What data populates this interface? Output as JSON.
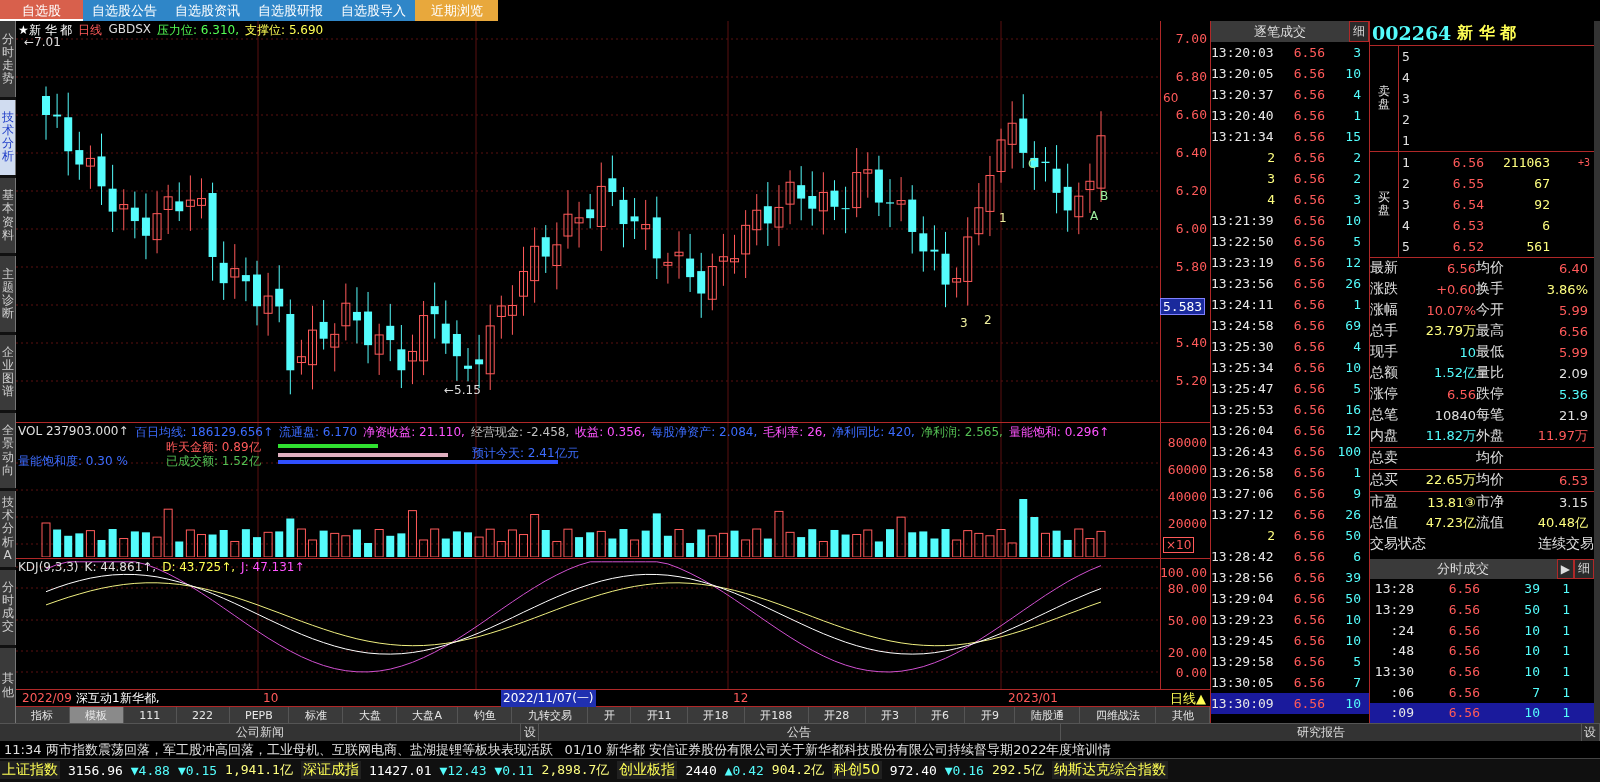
{
  "top_tabs": [
    {
      "label": "自选股",
      "selected": true,
      "color": "#d8604c"
    },
    {
      "label": "自选股公告",
      "selected": false,
      "color": "#2f86c8"
    },
    {
      "label": "自选股资讯",
      "selected": false,
      "color": "#2f86c8"
    },
    {
      "label": "自选股研报",
      "selected": false,
      "color": "#2f86c8"
    },
    {
      "label": "自选股导入",
      "selected": false,
      "color": "#2f86c8"
    },
    {
      "label": "近期浏览",
      "selected": false,
      "color": "#e8a83c"
    }
  ],
  "side_tabs": [
    {
      "label": "分时走势",
      "selected": false
    },
    {
      "label": "技术分析",
      "selected": true
    },
    {
      "label": "基本资料",
      "selected": false
    },
    {
      "label": "主题诊断",
      "selected": false
    },
    {
      "label": "企业图谱",
      "selected": false
    },
    {
      "label": "全景动向",
      "selected": false
    },
    {
      "label": "技术分析A",
      "selected": false
    },
    {
      "label": "分时成交",
      "selected": false
    },
    {
      "label": "其他",
      "selected": false
    }
  ],
  "price_panel": {
    "title": "★新 华 都",
    "period": "日线",
    "formula": "GBDSX",
    "resistance": "压力位: 6.310,",
    "support": "支撑位: 5.690",
    "high_marker": "←7.01",
    "low_marker": "←5.15",
    "wave_labels": [
      "1",
      "2",
      "3",
      "A",
      "B",
      "C"
    ],
    "axis": [
      "7.00",
      "6.80",
      "6.60",
      "6.40",
      "6.20",
      "6.00",
      "5.80",
      "5.40",
      "5.20"
    ],
    "axis_tag": "60",
    "current_price": "5.583"
  },
  "volume_panel": {
    "indicators": [
      {
        "text": "VOL 237903.000↑",
        "color": "#e0e0e0"
      },
      {
        "text": "百日均线: 186129.656↑",
        "color": "#3c6cff"
      },
      {
        "text": "流通盘: 6.170",
        "color": "#3c6cff"
      },
      {
        "text": "净资收益: 21.110,",
        "color": "#ff54ff"
      },
      {
        "text": "经营现金: -2.458,",
        "color": "#c0c0c0"
      },
      {
        "text": "收益: 0.356,",
        "color": "#ff54ff"
      },
      {
        "text": "每股净资产: 2.084,",
        "color": "#3c6cff"
      },
      {
        "text": "毛利率: 26,",
        "color": "#ff54ff"
      },
      {
        "text": "净利同比: 420,",
        "color": "#3c6cff"
      },
      {
        "text": "净利润: 2.565,",
        "color": "#54c054"
      },
      {
        "text": "量能饱和: 0.296↑",
        "color": "#ff54ff"
      }
    ],
    "yesterday_amount": "昨天金额: 0.89亿",
    "saturation": "量能饱和度: 0.30 %",
    "traded_amount": "已成交额: 1.52亿",
    "forecast": "预计今天: 2.41亿元",
    "axis": [
      "80000",
      "60000",
      "40000",
      "20000"
    ],
    "scale": "×10"
  },
  "kdj_panel": {
    "name": "KDJ(9,3,3)",
    "values": [
      {
        "text": "K: 44.861↑,",
        "color": "#e0e0e0"
      },
      {
        "text": "D: 43.725↑,",
        "color": "#ffff54"
      },
      {
        "text": "J: 47.131↑",
        "color": "#ff54ff"
      }
    ],
    "axis": [
      "100.00",
      "80.00",
      "50.00",
      "20.00",
      "0.00"
    ]
  },
  "date_axis": [
    {
      "label": "2022/09",
      "selected": false
    },
    {
      "label": "10",
      "selected": false
    },
    {
      "label": "2022/11/07(一)",
      "selected": true
    },
    {
      "label": "12",
      "selected": false
    },
    {
      "label": "2023/01",
      "selected": false
    }
  ],
  "ticker": "深互动1新华都,",
  "period_button": "日线▲",
  "formula_tabs": [
    {
      "label": "指标",
      "selected": false
    },
    {
      "label": "模板",
      "selected": true
    },
    {
      "label": "111",
      "selected": false
    },
    {
      "label": "222",
      "selected": false
    },
    {
      "label": "PEPB",
      "selected": false
    },
    {
      "label": "标准",
      "selected": false
    },
    {
      "label": "大盘",
      "selected": false
    },
    {
      "label": "大盘A",
      "selected": false
    },
    {
      "label": "钓鱼",
      "selected": false
    },
    {
      "label": "九转交易",
      "selected": false
    },
    {
      "label": "开",
      "selected": false
    },
    {
      "label": "开11",
      "selected": false
    },
    {
      "label": "开18",
      "selected": false
    },
    {
      "label": "开188",
      "selected": false
    },
    {
      "label": "开28",
      "selected": false
    },
    {
      "label": "开3",
      "selected": false
    },
    {
      "label": "开6",
      "selected": false
    },
    {
      "label": "开9",
      "selected": false
    },
    {
      "label": "陆股通",
      "selected": false
    },
    {
      "label": "四维战法",
      "selected": false
    },
    {
      "label": "其他",
      "selected": false
    }
  ],
  "tick_list": {
    "title": "逐笔成交",
    "detail": "细",
    "rows": [
      {
        "kind": "time",
        "time": "13:20:03",
        "price": "6.56",
        "volume": "3",
        "selected": false
      },
      {
        "kind": "time",
        "time": "13:20:05",
        "price": "6.56",
        "volume": "10",
        "selected": false
      },
      {
        "kind": "time",
        "time": "13:20:37",
        "price": "6.56",
        "volume": "4",
        "selected": false
      },
      {
        "kind": "time",
        "time": "13:20:40",
        "price": "6.56",
        "volume": "1",
        "selected": false
      },
      {
        "kind": "time",
        "time": "13:21:34",
        "price": "6.56",
        "volume": "15",
        "selected": false
      },
      {
        "kind": "sequence",
        "time": "2",
        "price": "6.56",
        "volume": "2",
        "selected": false
      },
      {
        "kind": "sequence",
        "time": "3",
        "price": "6.56",
        "volume": "2",
        "selected": false
      },
      {
        "kind": "sequence",
        "time": "4",
        "price": "6.56",
        "volume": "3",
        "selected": false
      },
      {
        "kind": "time",
        "time": "13:21:39",
        "price": "6.56",
        "volume": "10",
        "selected": false
      },
      {
        "kind": "time",
        "time": "13:22:50",
        "price": "6.56",
        "volume": "5",
        "selected": false
      },
      {
        "kind": "time",
        "time": "13:23:19",
        "price": "6.56",
        "volume": "12",
        "selected": false
      },
      {
        "kind": "time",
        "time": "13:23:56",
        "price": "6.56",
        "volume": "26",
        "selected": false
      },
      {
        "kind": "time",
        "time": "13:24:11",
        "price": "6.56",
        "volume": "1",
        "selected": false
      },
      {
        "kind": "time",
        "time": "13:24:58",
        "price": "6.56",
        "volume": "69",
        "selected": false
      },
      {
        "kind": "time",
        "time": "13:25:30",
        "price": "6.56",
        "volume": "4",
        "selected": false
      },
      {
        "kind": "time",
        "time": "13:25:34",
        "price": "6.56",
        "volume": "10",
        "selected": false
      },
      {
        "kind": "time",
        "time": "13:25:47",
        "price": "6.56",
        "volume": "5",
        "selected": false
      },
      {
        "kind": "time",
        "time": "13:25:53",
        "price": "6.56",
        "volume": "16",
        "selected": false
      },
      {
        "kind": "time",
        "time": "13:26:04",
        "price": "6.56",
        "volume": "12",
        "selected": false
      },
      {
        "kind": "time",
        "time": "13:26:43",
        "price": "6.56",
        "volume": "100",
        "selected": false
      },
      {
        "kind": "time",
        "time": "13:26:58",
        "price": "6.56",
        "volume": "1",
        "selected": false
      },
      {
        "kind": "time",
        "time": "13:27:06",
        "price": "6.56",
        "volume": "9",
        "selected": false
      },
      {
        "kind": "time",
        "time": "13:27:12",
        "price": "6.56",
        "volume": "26",
        "selected": false
      },
      {
        "kind": "sequence",
        "time": "2",
        "price": "6.56",
        "volume": "50",
        "selected": false
      },
      {
        "kind": "time",
        "time": "13:28:42",
        "price": "6.56",
        "volume": "6",
        "selected": false
      },
      {
        "kind": "time",
        "time": "13:28:56",
        "price": "6.56",
        "volume": "39",
        "selected": false
      },
      {
        "kind": "time",
        "time": "13:29:04",
        "price": "6.56",
        "volume": "50",
        "selected": false
      },
      {
        "kind": "time",
        "time": "13:29:23",
        "price": "6.56",
        "volume": "10",
        "selected": false
      },
      {
        "kind": "time",
        "time": "13:29:45",
        "price": "6.56",
        "volume": "10",
        "selected": false
      },
      {
        "kind": "time",
        "time": "13:29:58",
        "price": "6.56",
        "volume": "5",
        "selected": false
      },
      {
        "kind": "time",
        "time": "13:30:05",
        "price": "6.56",
        "volume": "7",
        "selected": false
      },
      {
        "kind": "time",
        "time": "13:30:09",
        "price": "6.56",
        "volume": "10",
        "selected": true
      }
    ]
  },
  "quote": {
    "code": "002264",
    "name": "新 华 都",
    "sell_label": "卖盘",
    "buy_label": "买盘",
    "asks": [
      {
        "rank": "5"
      },
      {
        "rank": "4"
      },
      {
        "rank": "3"
      },
      {
        "rank": "2"
      },
      {
        "rank": "1"
      }
    ],
    "bids": [
      {
        "rank": "1",
        "price": "6.56",
        "volume": "211063",
        "extra": "+3"
      },
      {
        "rank": "2",
        "price": "6.55",
        "volume": "67"
      },
      {
        "rank": "3",
        "price": "6.54",
        "volume": "92"
      },
      {
        "rank": "4",
        "price": "6.53",
        "volume": "6"
      },
      {
        "rank": "5",
        "price": "6.52",
        "volume": "561"
      }
    ],
    "stats": [
      [
        {
          "label": "最新",
          "value": "6.56",
          "color": "#ff5a5a"
        },
        {
          "label": "均价",
          "value": "6.40",
          "color": "#ff5a5a"
        }
      ],
      [
        {
          "label": "涨跌",
          "value": "+0.60",
          "color": "#ff5a5a"
        },
        {
          "label": "换手",
          "value": "3.86%",
          "color": "#ffff80"
        }
      ],
      [
        {
          "label": "涨幅",
          "value": "10.07%",
          "color": "#ff5a5a"
        },
        {
          "label": "今开",
          "value": "5.99",
          "color": "#ff5a5a"
        }
      ],
      [
        {
          "label": "总手",
          "value": "23.79万",
          "color": "#ffff80"
        },
        {
          "label": "最高",
          "value": "6.56",
          "color": "#ff5a5a"
        }
      ],
      [
        {
          "label": "现手",
          "value": "10",
          "color": "#54fcfc"
        },
        {
          "label": "最低",
          "value": "5.99",
          "color": "#ff5a5a"
        }
      ],
      [
        {
          "label": "总额",
          "value": "1.52亿",
          "color": "#54fcfc"
        },
        {
          "label": "量比",
          "value": "2.09",
          "color": "#e0e0e0"
        }
      ],
      [
        {
          "label": "涨停",
          "value": "6.56",
          "color": "#ff5a5a"
        },
        {
          "label": "跌停",
          "value": "5.36",
          "color": "#54fcfc"
        }
      ],
      [
        {
          "label": "总笔",
          "value": "10840",
          "color": "#e0e0e0"
        },
        {
          "label": "每笔",
          "value": "21.9",
          "color": "#e0e0e0"
        }
      ],
      [
        {
          "label": "内盘",
          "value": "11.82万",
          "color": "#54fcfc"
        },
        {
          "label": "外盘",
          "value": "11.97万",
          "color": "#ff5a5a"
        }
      ]
    ],
    "total_sell": {
      "label": "总卖",
      "avg_label": "均价"
    },
    "total_buy": {
      "label": "总买",
      "value": "22.65万",
      "avg_label": "均价",
      "avg_value": "6.53"
    },
    "valuation": [
      [
        {
          "label": "市盈",
          "value": "13.81③",
          "color": "#ffff80"
        },
        {
          "label": "市净",
          "value": "3.15",
          "color": "#e0e0e0"
        }
      ],
      [
        {
          "label": "总值",
          "value": "47.23亿",
          "color": "#ffff80"
        },
        {
          "label": "流值",
          "value": "40.48亿",
          "color": "#ffff80"
        }
      ]
    ],
    "status_label": "交易状态",
    "status_value": "连续交易"
  },
  "minute_trades": {
    "title": "分时成交",
    "arrow": "▶",
    "detail": "细",
    "rows": [
      {
        "time": "13:28",
        "price": "6.56",
        "volume": "39",
        "count": "1",
        "selected": false
      },
      {
        "time": "13:29",
        "price": "6.56",
        "volume": "50",
        "count": "1",
        "selected": false
      },
      {
        "time": ":24",
        "price": "6.56",
        "volume": "10",
        "count": "1",
        "selected": false
      },
      {
        "time": ":48",
        "price": "6.56",
        "volume": "10",
        "count": "1",
        "selected": false
      },
      {
        "time": "13:30",
        "price": "6.56",
        "volume": "10",
        "count": "1",
        "selected": false
      },
      {
        "time": ":06",
        "price": "6.56",
        "volume": "7",
        "count": "1",
        "selected": false
      },
      {
        "time": ":09",
        "price": "6.56",
        "volume": "10",
        "count": "1",
        "selected": true
      }
    ]
  },
  "news_tabs": [
    {
      "kind": "tab",
      "label": "公司新闻"
    },
    {
      "kind": "settings",
      "label": "设"
    },
    {
      "kind": "tab",
      "label": "公告"
    },
    {
      "kind": "tab",
      "label": "研究报告"
    },
    {
      "kind": "settings",
      "label": "设"
    }
  ],
  "news": [
    {
      "time": "11:34",
      "text": "两市指数震荡回落，军工股冲高回落，工业母机、互联网电商、盐湖提锂等板块表现活跃"
    },
    {
      "time": "01/10",
      "text": "新华都 安信证券股份有限公司关于新华都科技股份有限公司持续督导期2022年度培训情"
    }
  ],
  "indices": [
    {
      "name": "上证指数",
      "value": "3156.96",
      "change": "▼4.88",
      "pct": "▼0.15",
      "amount": "1,941.1亿"
    },
    {
      "name": "深证成指",
      "value": "11427.01",
      "change": "▼12.43",
      "pct": "▼0.11",
      "amount": "2,898.7亿"
    },
    {
      "name": "创业板指",
      "value": "2440",
      "pct": "▲0.42",
      "amount": "904.2亿"
    },
    {
      "name": "科创50",
      "value": "972.40",
      "pct": "▼0.16",
      "amount": "292.5亿"
    },
    {
      "name": "纳斯达克综合指数"
    }
  ]
}
